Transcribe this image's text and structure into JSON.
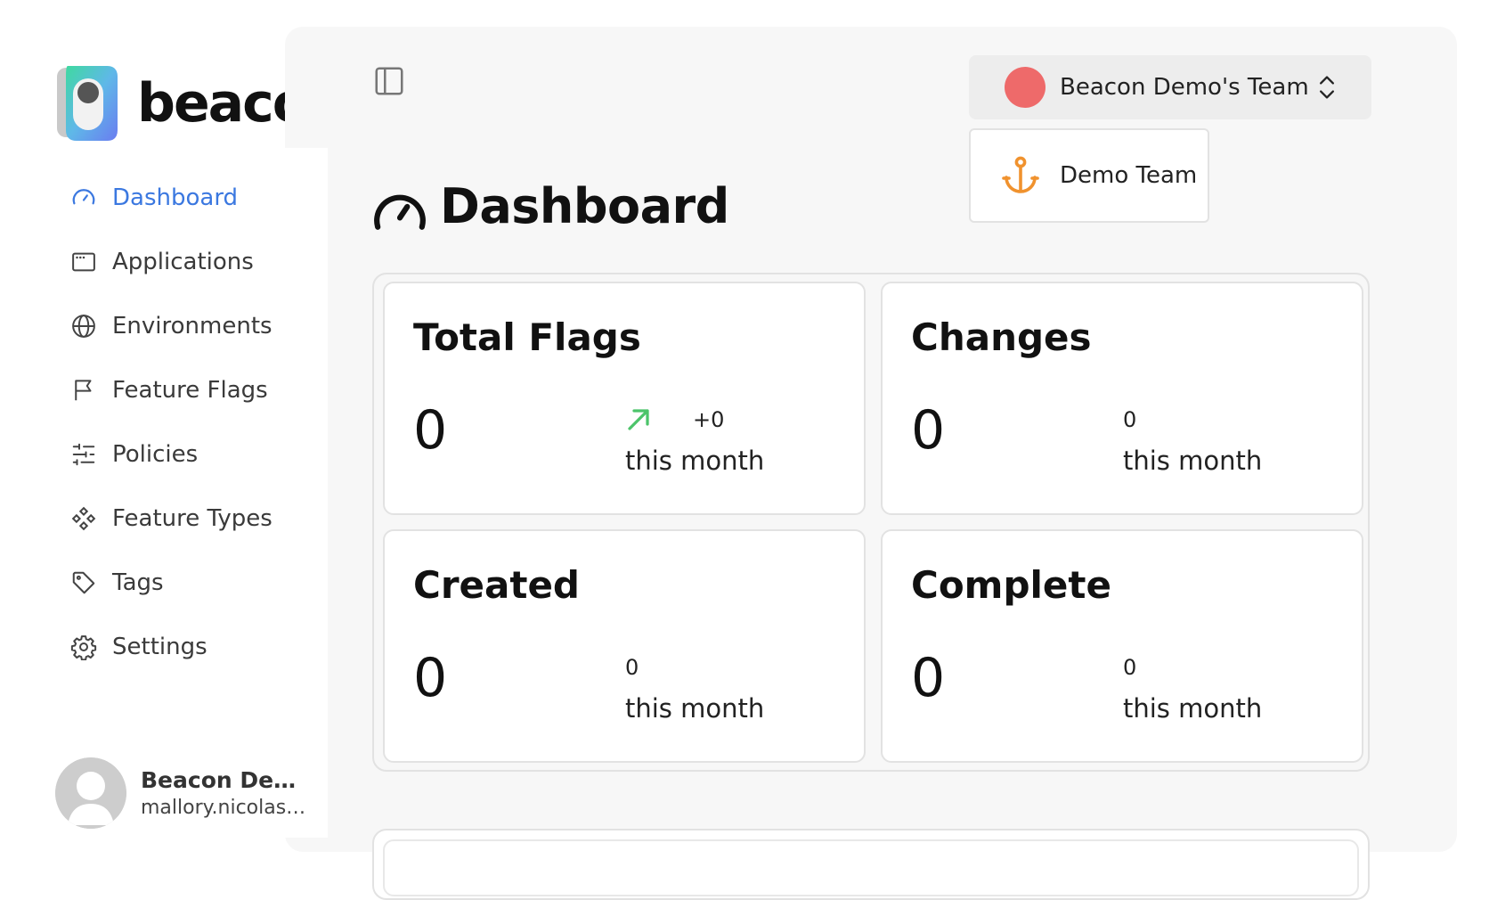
{
  "brand": {
    "name": "beacon"
  },
  "nav": {
    "items": [
      {
        "label": "Dashboard",
        "icon": "gauge-icon",
        "active": true
      },
      {
        "label": "Applications",
        "icon": "window-icon"
      },
      {
        "label": "Environments",
        "icon": "globe-icon"
      },
      {
        "label": "Feature Flags",
        "icon": "flag-icon"
      },
      {
        "label": "Policies",
        "icon": "sliders-icon"
      },
      {
        "label": "Feature Types",
        "icon": "components-icon"
      },
      {
        "label": "Tags",
        "icon": "tag-icon"
      },
      {
        "label": "Settings",
        "icon": "gear-icon"
      }
    ]
  },
  "user": {
    "name": "Beacon Demo…",
    "email": "mallory.nicolas…"
  },
  "team_switcher": {
    "current": "Beacon Demo's Team",
    "color": "#ee6a6a"
  },
  "team_menu": {
    "items": [
      {
        "label": "Demo Team",
        "icon": "anchor-icon",
        "color": "#f0922e"
      }
    ]
  },
  "page": {
    "title": "Dashboard"
  },
  "stats": [
    {
      "title": "Total Flags",
      "value": "0",
      "delta": "+0",
      "period": "this month",
      "trend": "up"
    },
    {
      "title": "Changes",
      "value": "0",
      "delta": "0",
      "period": "this month"
    },
    {
      "title": "Created",
      "value": "0",
      "delta": "0",
      "period": "this month"
    },
    {
      "title": "Complete",
      "value": "0",
      "delta": "0",
      "period": "this month"
    }
  ],
  "colors": {
    "accent": "#3b78e0",
    "trend_up": "#4cc46a"
  }
}
